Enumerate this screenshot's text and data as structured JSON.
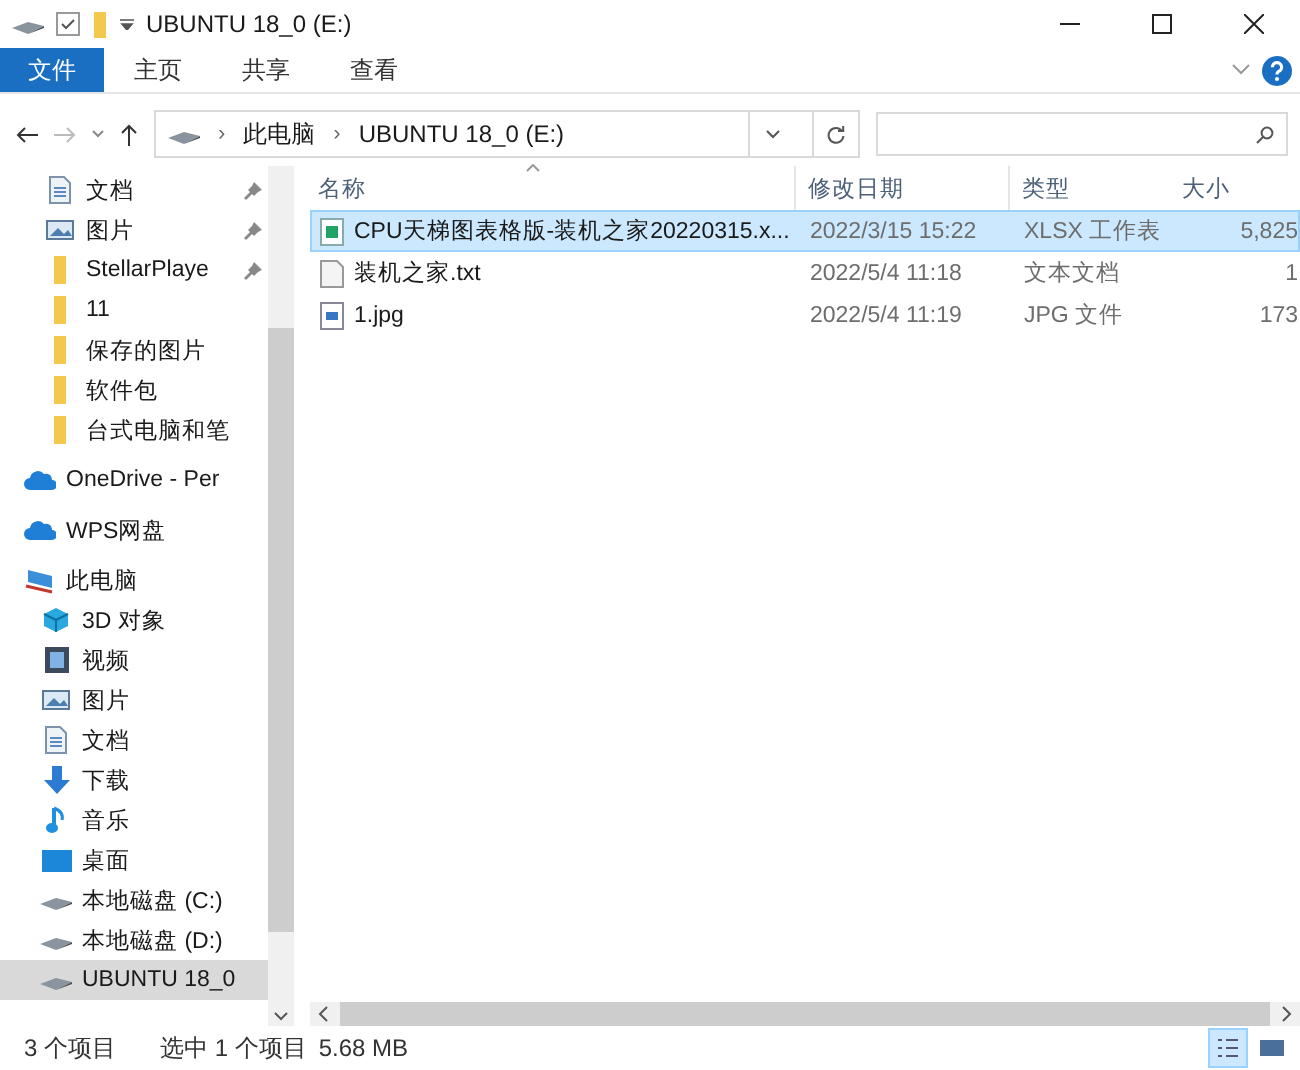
{
  "window": {
    "title": "UBUNTU 18_0 (E:)"
  },
  "ribbon": {
    "tabs": [
      {
        "label": "文件",
        "selected": true
      },
      {
        "label": "主页",
        "selected": false
      },
      {
        "label": "共享",
        "selected": false
      },
      {
        "label": "查看",
        "selected": false
      }
    ]
  },
  "address": {
    "crumbs": [
      {
        "separator": "›",
        "label": "此电脑"
      },
      {
        "separator": "›",
        "label": "UBUNTU 18_0 (E:)"
      }
    ]
  },
  "nav": {
    "quick_access": [
      {
        "label": "文档",
        "kind": "document",
        "pinned": true
      },
      {
        "label": "图片",
        "kind": "pictures",
        "pinned": true
      },
      {
        "label": "StellarPlaye",
        "kind": "folder",
        "pinned": true
      },
      {
        "label": "11",
        "kind": "folder",
        "pinned": false
      },
      {
        "label": "保存的图片",
        "kind": "folder",
        "pinned": false
      },
      {
        "label": "软件包",
        "kind": "folder",
        "pinned": false
      },
      {
        "label": "台式电脑和笔",
        "kind": "folder",
        "pinned": false
      }
    ],
    "locations": [
      {
        "label": "OneDrive - Per",
        "kind": "cloud",
        "selected": false
      },
      {
        "label": "WPS网盘",
        "kind": "cloud",
        "selected": false
      },
      {
        "label": "此电脑",
        "kind": "pc",
        "selected": false,
        "children": [
          {
            "label": "3D 对象",
            "kind": "cube",
            "selected": false
          },
          {
            "label": "视频",
            "kind": "video",
            "selected": false
          },
          {
            "label": "图片",
            "kind": "pictures",
            "selected": false
          },
          {
            "label": "文档",
            "kind": "document",
            "selected": false
          },
          {
            "label": "下载",
            "kind": "download",
            "selected": false
          },
          {
            "label": "音乐",
            "kind": "music",
            "selected": false
          },
          {
            "label": "桌面",
            "kind": "desktop",
            "selected": false
          },
          {
            "label": "本地磁盘 (C:)",
            "kind": "drive",
            "selected": false
          },
          {
            "label": "本地磁盘 (D:)",
            "kind": "drive",
            "selected": false
          },
          {
            "label": "UBUNTU 18_0",
            "kind": "drive",
            "selected": true
          }
        ]
      }
    ]
  },
  "files": {
    "columns": [
      "名称",
      "修改日期",
      "类型",
      "大小"
    ],
    "rows": [
      {
        "name": "CPU天梯图表格版-装机之家20220315.x...",
        "kind": "sheet",
        "modified": "2022/3/15 15:22",
        "type": "XLSX 工作表",
        "size": "5,825",
        "selected": true
      },
      {
        "name": "装机之家.txt",
        "kind": "text",
        "modified": "2022/5/4 11:18",
        "type": "文本文档",
        "size": "1",
        "selected": false
      },
      {
        "name": "1.jpg",
        "kind": "image",
        "modified": "2022/5/4 11:19",
        "type": "JPG 文件",
        "size": "173",
        "selected": false
      }
    ]
  },
  "status_bar": {
    "count": "3 个项目",
    "selection": "选中 1 个项目",
    "size": "5.68 MB",
    "views": [
      {
        "kind": "details",
        "selected": true
      },
      {
        "kind": "large",
        "selected": false
      }
    ]
  }
}
